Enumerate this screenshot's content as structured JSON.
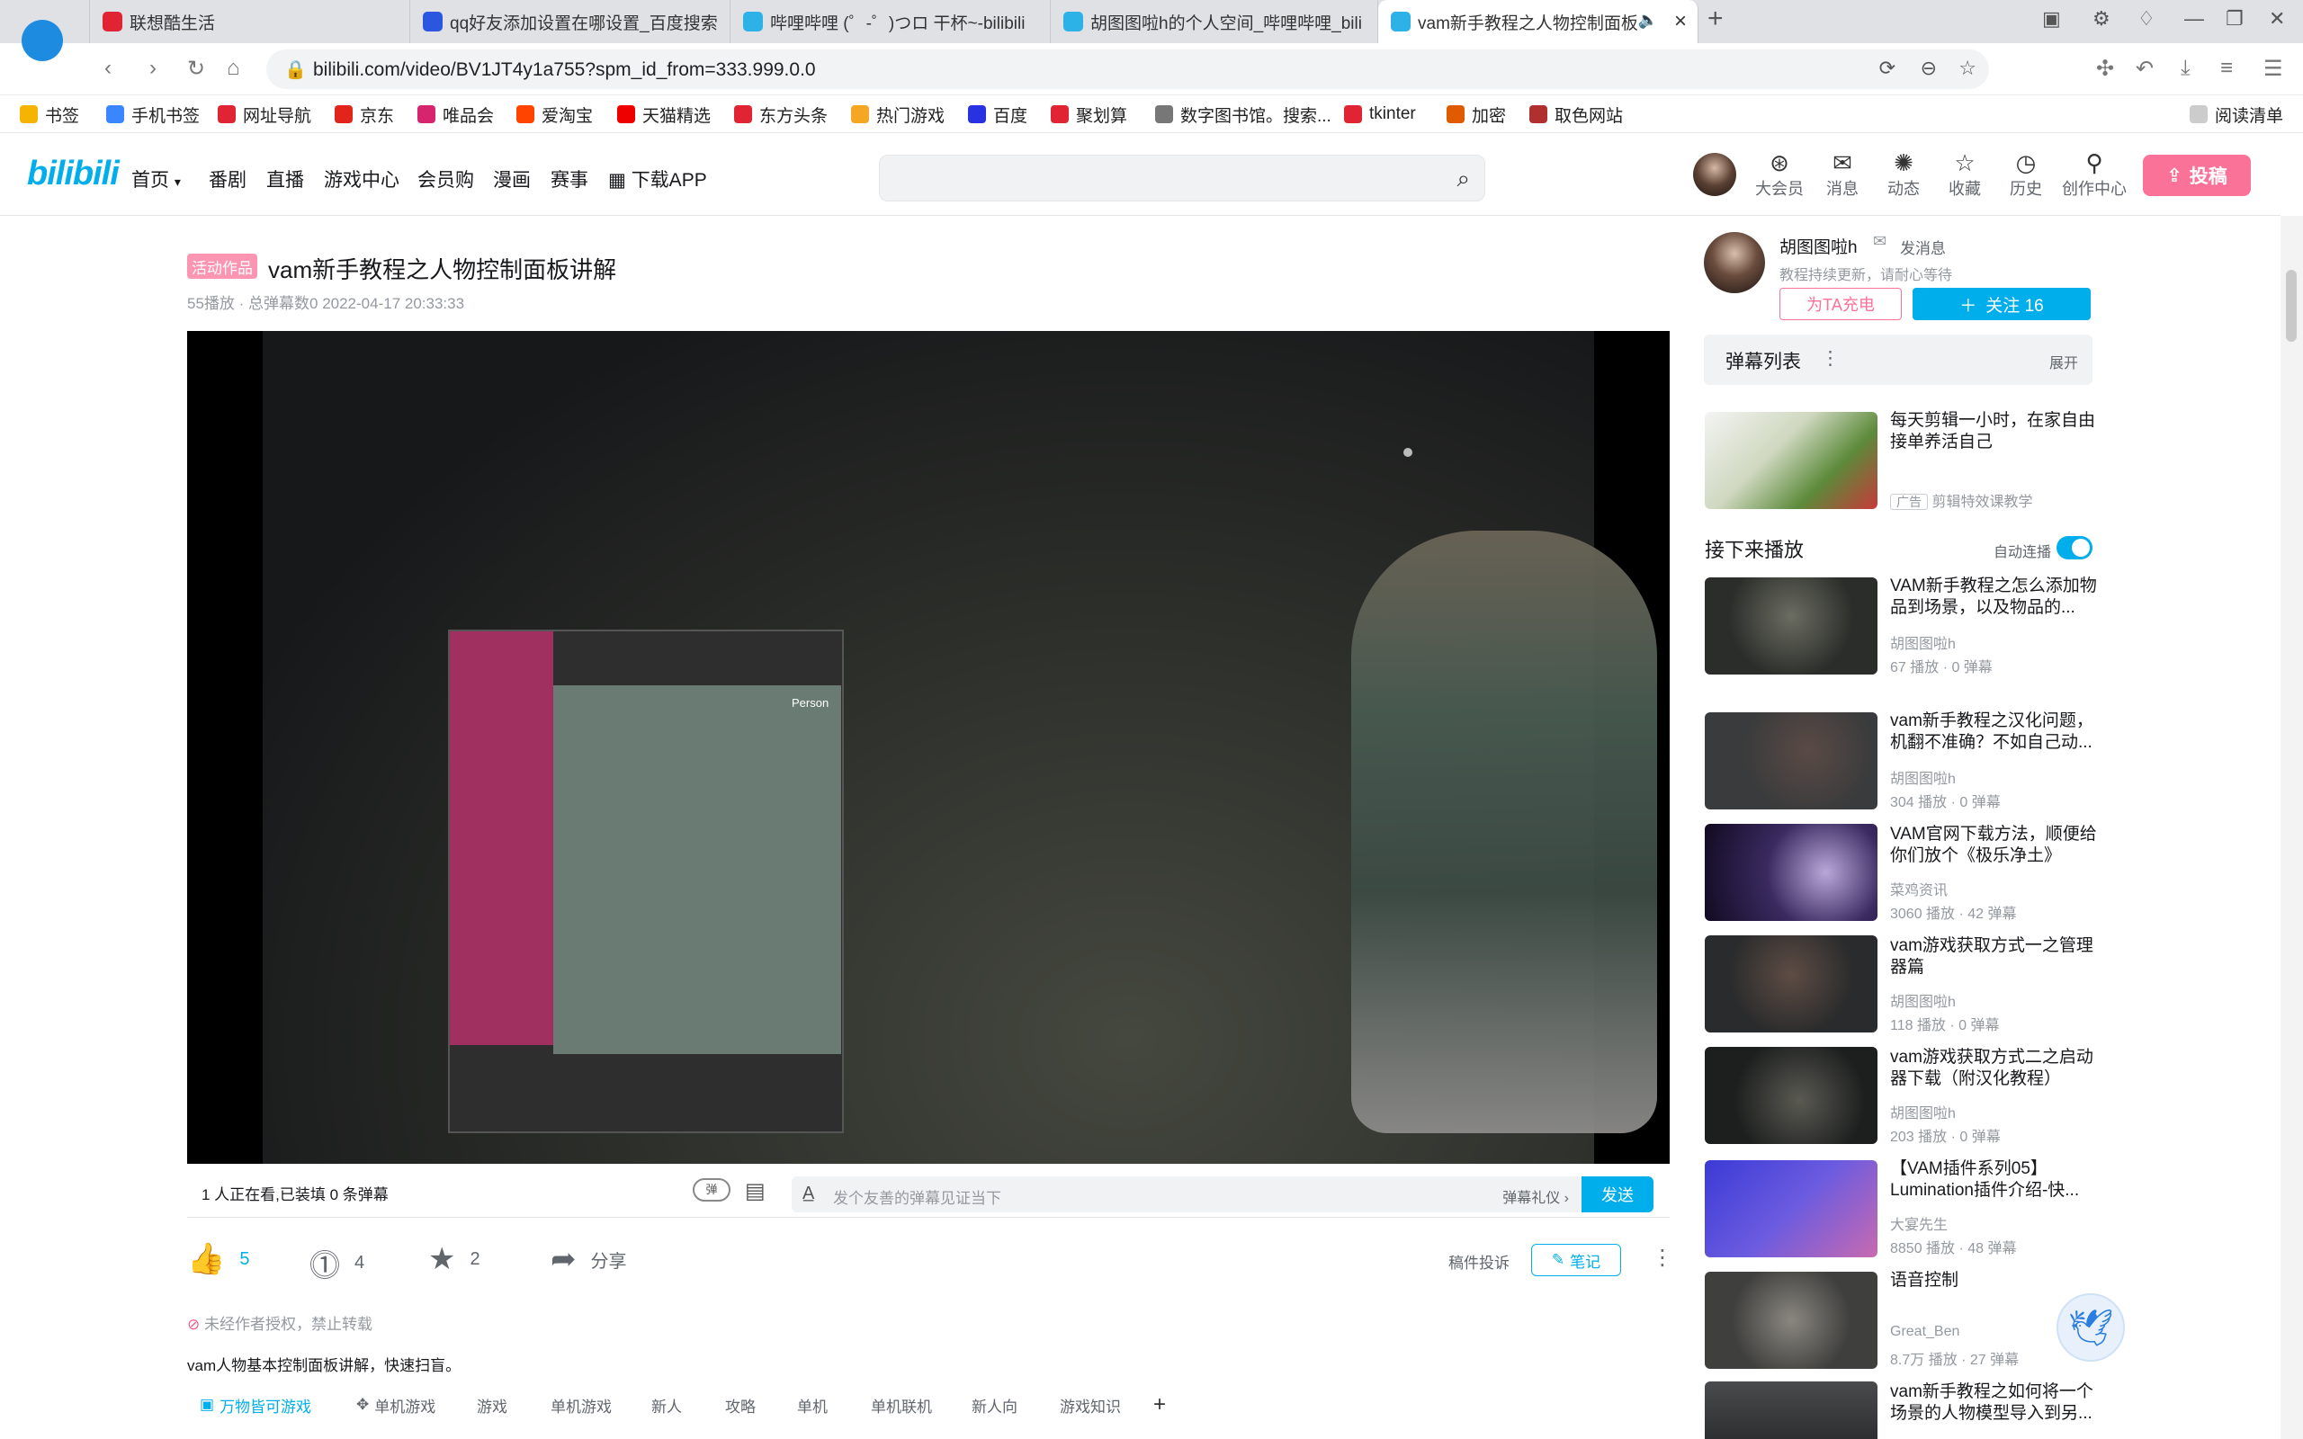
{
  "browser": {
    "tabs": [
      {
        "label": "联想酷生活",
        "color": "#e02433"
      },
      {
        "label": "qq好友添加设置在哪设置_百度搜索",
        "color": "#2b56e0"
      },
      {
        "label": "哔哩哔哩 (゜-゜)つロ 干杯~-bilibili",
        "color": "#2db2e8"
      },
      {
        "label": "胡图图啦h的个人空间_哔哩哔哩_bili",
        "color": "#2db2e8"
      },
      {
        "label": "vam新手教程之人物控制面板",
        "color": "#2db2e8"
      }
    ],
    "url": "bilibili.com/video/BV1JT4y1a755?spm_id_from=333.999.0.0",
    "bookmarks": [
      {
        "label": "书签",
        "color": "#f5b400"
      },
      {
        "label": "手机书签",
        "color": "#3a86ff"
      },
      {
        "label": "网址导航",
        "color": "#e02433"
      },
      {
        "label": "京东",
        "color": "#e1251b"
      },
      {
        "label": "唯品会",
        "color": "#d6246e"
      },
      {
        "label": "爱淘宝",
        "color": "#ff4400"
      },
      {
        "label": "天猫精选",
        "color": "#e00"
      },
      {
        "label": "东方头条",
        "color": "#e02433"
      },
      {
        "label": "热门游戏",
        "color": "#f5a623"
      },
      {
        "label": "百度",
        "color": "#2932e1"
      },
      {
        "label": "聚划算",
        "color": "#e02433"
      },
      {
        "label": "数字图书馆。搜索...",
        "color": "#777777"
      },
      {
        "label": "tkinter",
        "color": "#e02433"
      },
      {
        "label": "加密",
        "color": "#e05a00"
      },
      {
        "label": "取色网站",
        "color": "#b03030"
      }
    ],
    "reading_list": "阅读清单"
  },
  "site": {
    "logo": "bilibili",
    "nav": [
      "首页",
      "番剧",
      "直播",
      "游戏中心",
      "会员购",
      "漫画",
      "赛事",
      "下载APP"
    ],
    "header_icons": [
      "大会员",
      "消息",
      "动态",
      "收藏",
      "历史",
      "创作中心"
    ],
    "upload": "投稿"
  },
  "video": {
    "badge": "活动作品",
    "title": "vam新手教程之人物控制面板讲解",
    "meta": "55播放 · 总弹幕数0   2022-04-17 20:33:33",
    "panel_title": "Person",
    "viewers": "1 人正在看,已装填 0 条弹幕",
    "danmaku_placeholder": "发个友善的弹幕见证当下",
    "danmaku_etiquette": "弹幕礼仪",
    "send": "发送",
    "like": "5",
    "coin": "4",
    "fav": "2",
    "share": "分享",
    "report": "稿件投诉",
    "note": "笔记",
    "copyright": "未经作者授权，禁止转载",
    "desc": "vam人物基本控制面板讲解，快速扫盲。",
    "tags": [
      "万物皆可游戏",
      "单机游戏",
      "游戏",
      "单机游戏",
      "新人",
      "攻略",
      "单机",
      "单机联机",
      "新人向",
      "游戏知识"
    ]
  },
  "uploader": {
    "name": "胡图图啦h",
    "message": "发消息",
    "desc": "教程持续更新，请耐心等待",
    "charge": "为TA充电",
    "follow": "关注 16"
  },
  "sidebar": {
    "danmaku_list": "弹幕列表",
    "expand": "展开",
    "ad": {
      "title": "每天剪辑一小时，在家自由接单养活自己",
      "tag": "广告",
      "source": "剪辑特效课教学"
    },
    "next_up": "接下来播放",
    "autoplay": "自动连播",
    "items": [
      {
        "title": "VAM新手教程之怎么添加物品到场景，以及物品的...",
        "up": "胡图图啦h",
        "stats": "67 播放 · 0 弹幕",
        "bg": "#2b2d2a"
      },
      {
        "title": "vam新手教程之汉化问题，机翻不准确？不如自己动...",
        "up": "胡图图啦h",
        "stats": "304 播放 · 0 弹幕",
        "bg": "#3a3b3c"
      },
      {
        "title": "VAM官网下载方法，顺便给你们放个《极乐净土》",
        "up": "菜鸡资讯",
        "stats": "3060 播放 · 42 弹幕",
        "bg": "#1a1030"
      },
      {
        "title": "vam游戏获取方式一之管理器篇",
        "up": "胡图图啦h",
        "stats": "118 播放 · 0 弹幕",
        "bg": "#2a2b2c"
      },
      {
        "title": "vam游戏获取方式二之启动器下载（附汉化教程）",
        "up": "胡图图啦h",
        "stats": "203 播放 · 0 弹幕",
        "bg": "#1d1f1f"
      },
      {
        "title": "【VAM插件系列05】Lumination插件介绍-快...",
        "up": "大宴先生",
        "stats": "8850 播放 · 48 弹幕",
        "bg": "#3b3ad6"
      },
      {
        "title": "语音控制",
        "up": "Great_Ben",
        "stats": "8.7万 播放 · 27 弹幕",
        "bg": "#3f3f3d"
      },
      {
        "title": "vam新手教程之如何将一个场景的人物模型导入到另...",
        "up": "",
        "stats": "",
        "bg": "#2e2f30"
      }
    ]
  }
}
